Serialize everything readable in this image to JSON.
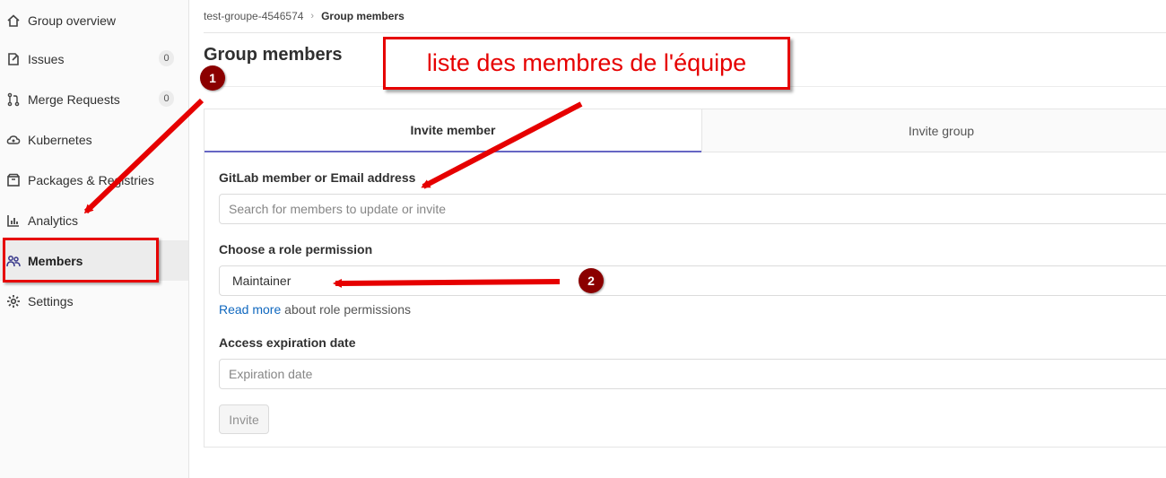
{
  "sidebar": {
    "items": [
      {
        "label": "Group overview",
        "icon": "home-icon"
      },
      {
        "label": "Issues",
        "icon": "issues-icon",
        "badge": "0"
      },
      {
        "label": "Merge Requests",
        "icon": "merge-request-icon",
        "badge": "0"
      },
      {
        "label": "Kubernetes",
        "icon": "kubernetes-icon"
      },
      {
        "label": "Packages & Registries",
        "icon": "package-icon"
      },
      {
        "label": "Analytics",
        "icon": "chart-icon"
      },
      {
        "label": "Members",
        "icon": "users-icon",
        "active": true
      },
      {
        "label": "Settings",
        "icon": "gear-icon"
      }
    ]
  },
  "breadcrumb": {
    "group": "test-groupe-4546574",
    "current": "Group members"
  },
  "page": {
    "title": "Group members"
  },
  "tabs": {
    "invite_member": "Invite member",
    "invite_group": "Invite group"
  },
  "form": {
    "member_label": "GitLab member or Email address",
    "member_placeholder": "Search for members to update or invite",
    "role_label": "Choose a role permission",
    "role_value": "Maintainer",
    "help_link": "Read more",
    "help_text": " about role permissions",
    "expiration_label": "Access expiration date",
    "expiration_placeholder": "Expiration date",
    "invite_button": "Invite"
  },
  "annotations": {
    "callout_text": "liste des membres de l'équipe",
    "step1": "1",
    "step2": "2",
    "color": "#e60000"
  }
}
